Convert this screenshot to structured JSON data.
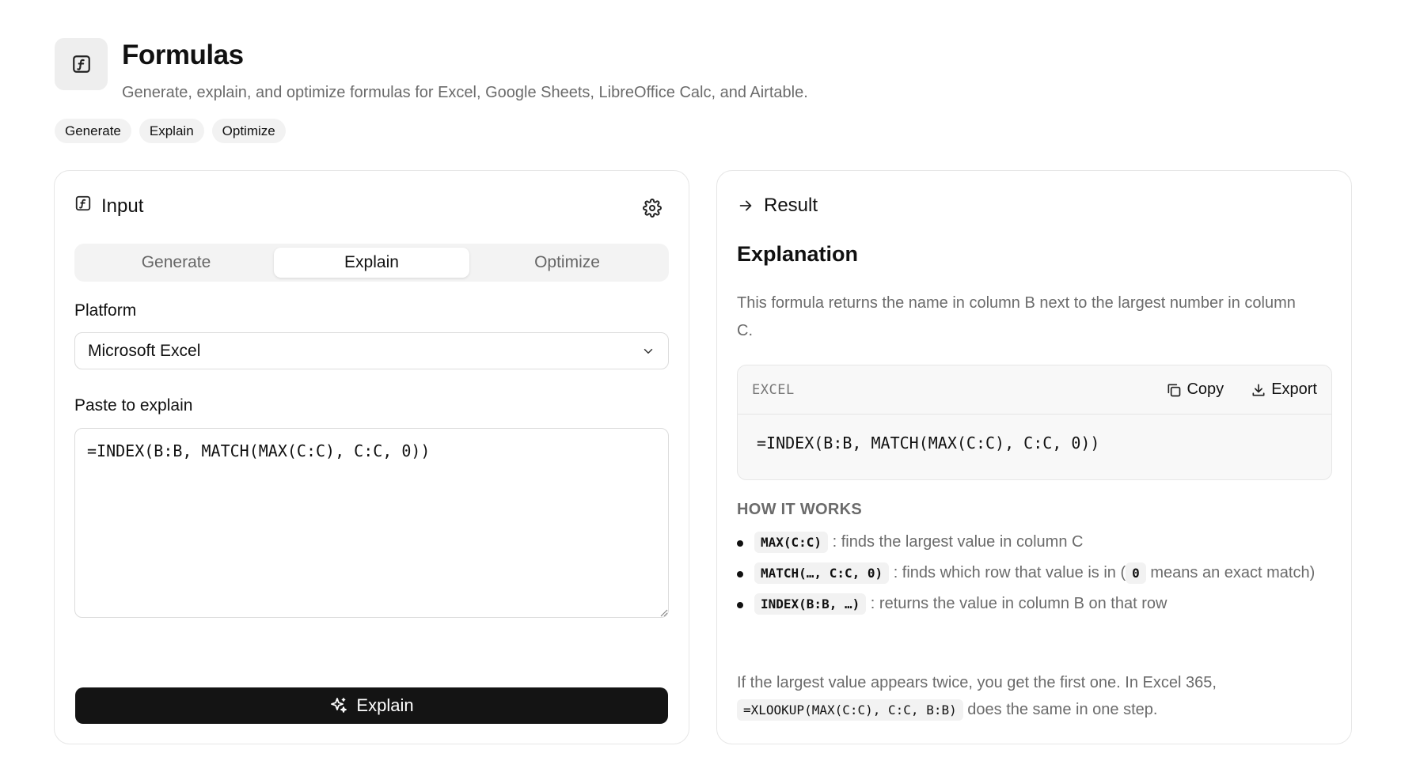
{
  "header": {
    "title": "Formulas",
    "subtitle": "Generate, explain, and optimize formulas for Excel, Google Sheets, LibreOffice Calc, and Airtable.",
    "chips": [
      "Generate",
      "Explain",
      "Optimize"
    ],
    "icon": "function-icon"
  },
  "input_card": {
    "title": "Input",
    "tabs": [
      "Generate",
      "Explain",
      "Optimize"
    ],
    "active_tab": "Explain",
    "platform_label": "Platform",
    "platform_value": "Microsoft Excel",
    "paste_label": "Paste to explain",
    "formula_value": "=INDEX(B:B, MATCH(MAX(C:C), C:C, 0))",
    "submit_label": "Explain"
  },
  "result_card": {
    "title": "Result",
    "explanation_title": "Explanation",
    "explanation_body": "This formula returns the name in column B next to the largest number in column C.",
    "code": {
      "lang": "EXCEL",
      "copy_label": "Copy",
      "export_label": "Export",
      "text": "=INDEX(B:B, MATCH(MAX(C:C), C:C, 0))"
    },
    "how_title": "HOW IT WORKS",
    "steps": [
      {
        "code": "MAX(C:C)",
        "text": ": finds the largest value in column C"
      },
      {
        "code": "MATCH(…, C:C, 0)",
        "text": ": finds which row that value is in (",
        "code2": "0",
        "text2": " means an exact match)"
      },
      {
        "code": "INDEX(B:B, …)",
        "text": ": returns the value in column B on that row"
      }
    ],
    "note_prefix": "If the largest value appears twice, you get the first one. In Excel 365,",
    "note_code": "=XLOOKUP(MAX(C:C), C:C, B:B)",
    "note_suffix": " does the same in one step."
  }
}
